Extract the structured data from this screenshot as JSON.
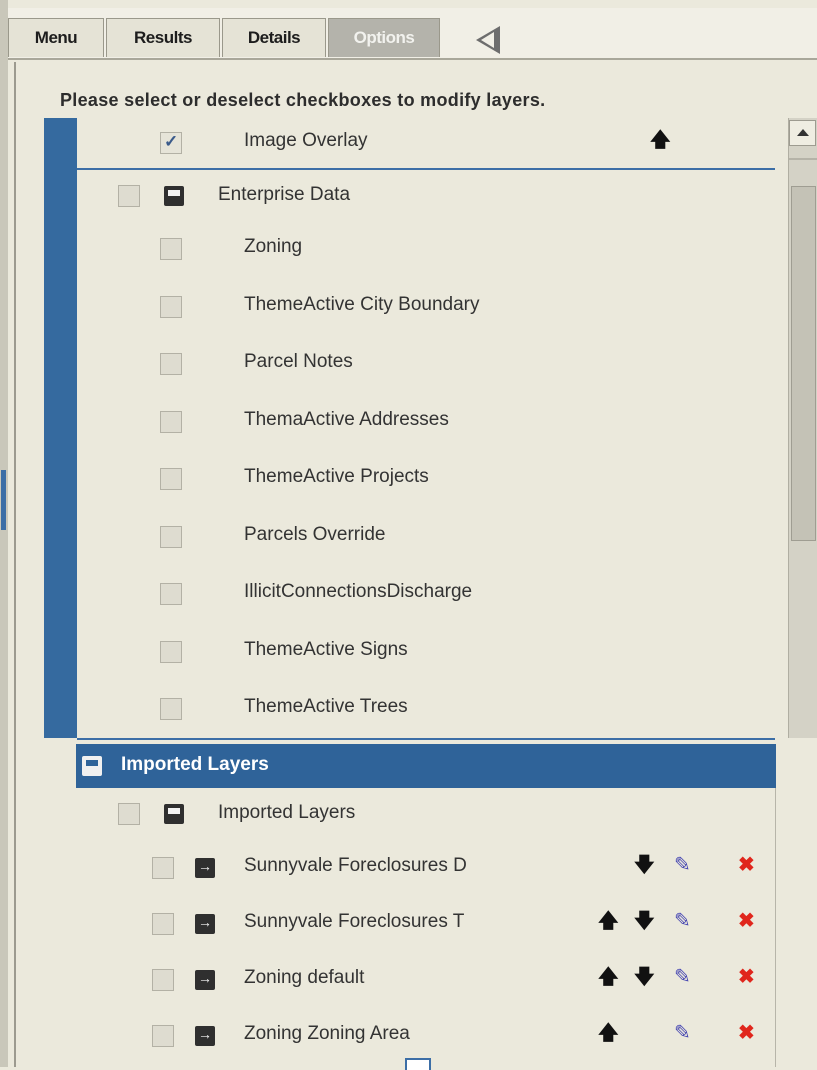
{
  "tabs": [
    {
      "label": "Menu",
      "active": false
    },
    {
      "label": "Results",
      "active": false
    },
    {
      "label": "Details",
      "active": false
    },
    {
      "label": "Options",
      "active": true
    }
  ],
  "instruction": "Please select or deselect checkboxes to modify layers.",
  "image_overlay": {
    "label": "Image Overlay",
    "checked": true
  },
  "enterprise_group": {
    "label": "Enterprise Data",
    "checked": false
  },
  "enterprise_layers": [
    {
      "label": "Zoning",
      "checked": false
    },
    {
      "label": "ThemeActive City Boundary",
      "checked": false
    },
    {
      "label": "Parcel Notes",
      "checked": false
    },
    {
      "label": "ThemaActive Addresses",
      "checked": false
    },
    {
      "label": "ThemeActive Projects",
      "checked": false
    },
    {
      "label": "Parcels Override",
      "checked": false
    },
    {
      "label": "IllicitConnectionsDischarge",
      "checked": false
    },
    {
      "label": "ThemeActive Signs",
      "checked": false
    },
    {
      "label": "ThemeActive Trees",
      "checked": false
    }
  ],
  "imported_header": "Imported Layers",
  "imported_group": {
    "label": "Imported Layers",
    "checked": false
  },
  "imported_layers": [
    {
      "label": "Sunnyvale Foreclosures D",
      "checked": false,
      "up": false,
      "down": true
    },
    {
      "label": "Sunnyvale Foreclosures T",
      "checked": false,
      "up": true,
      "down": true
    },
    {
      "label": "Zoning default",
      "checked": false,
      "up": true,
      "down": true
    },
    {
      "label": "Zoning Zoning Area",
      "checked": false,
      "up": true,
      "down": false
    }
  ],
  "colors": {
    "accent_blue": "#356a9f",
    "remove_red": "#e0261c",
    "panel_bg": "#ebe9dc"
  },
  "icons": {
    "up": "up-arrow-icon",
    "down": "down-arrow-icon",
    "edit": "edit-style-icon",
    "remove": "remove-icon"
  }
}
